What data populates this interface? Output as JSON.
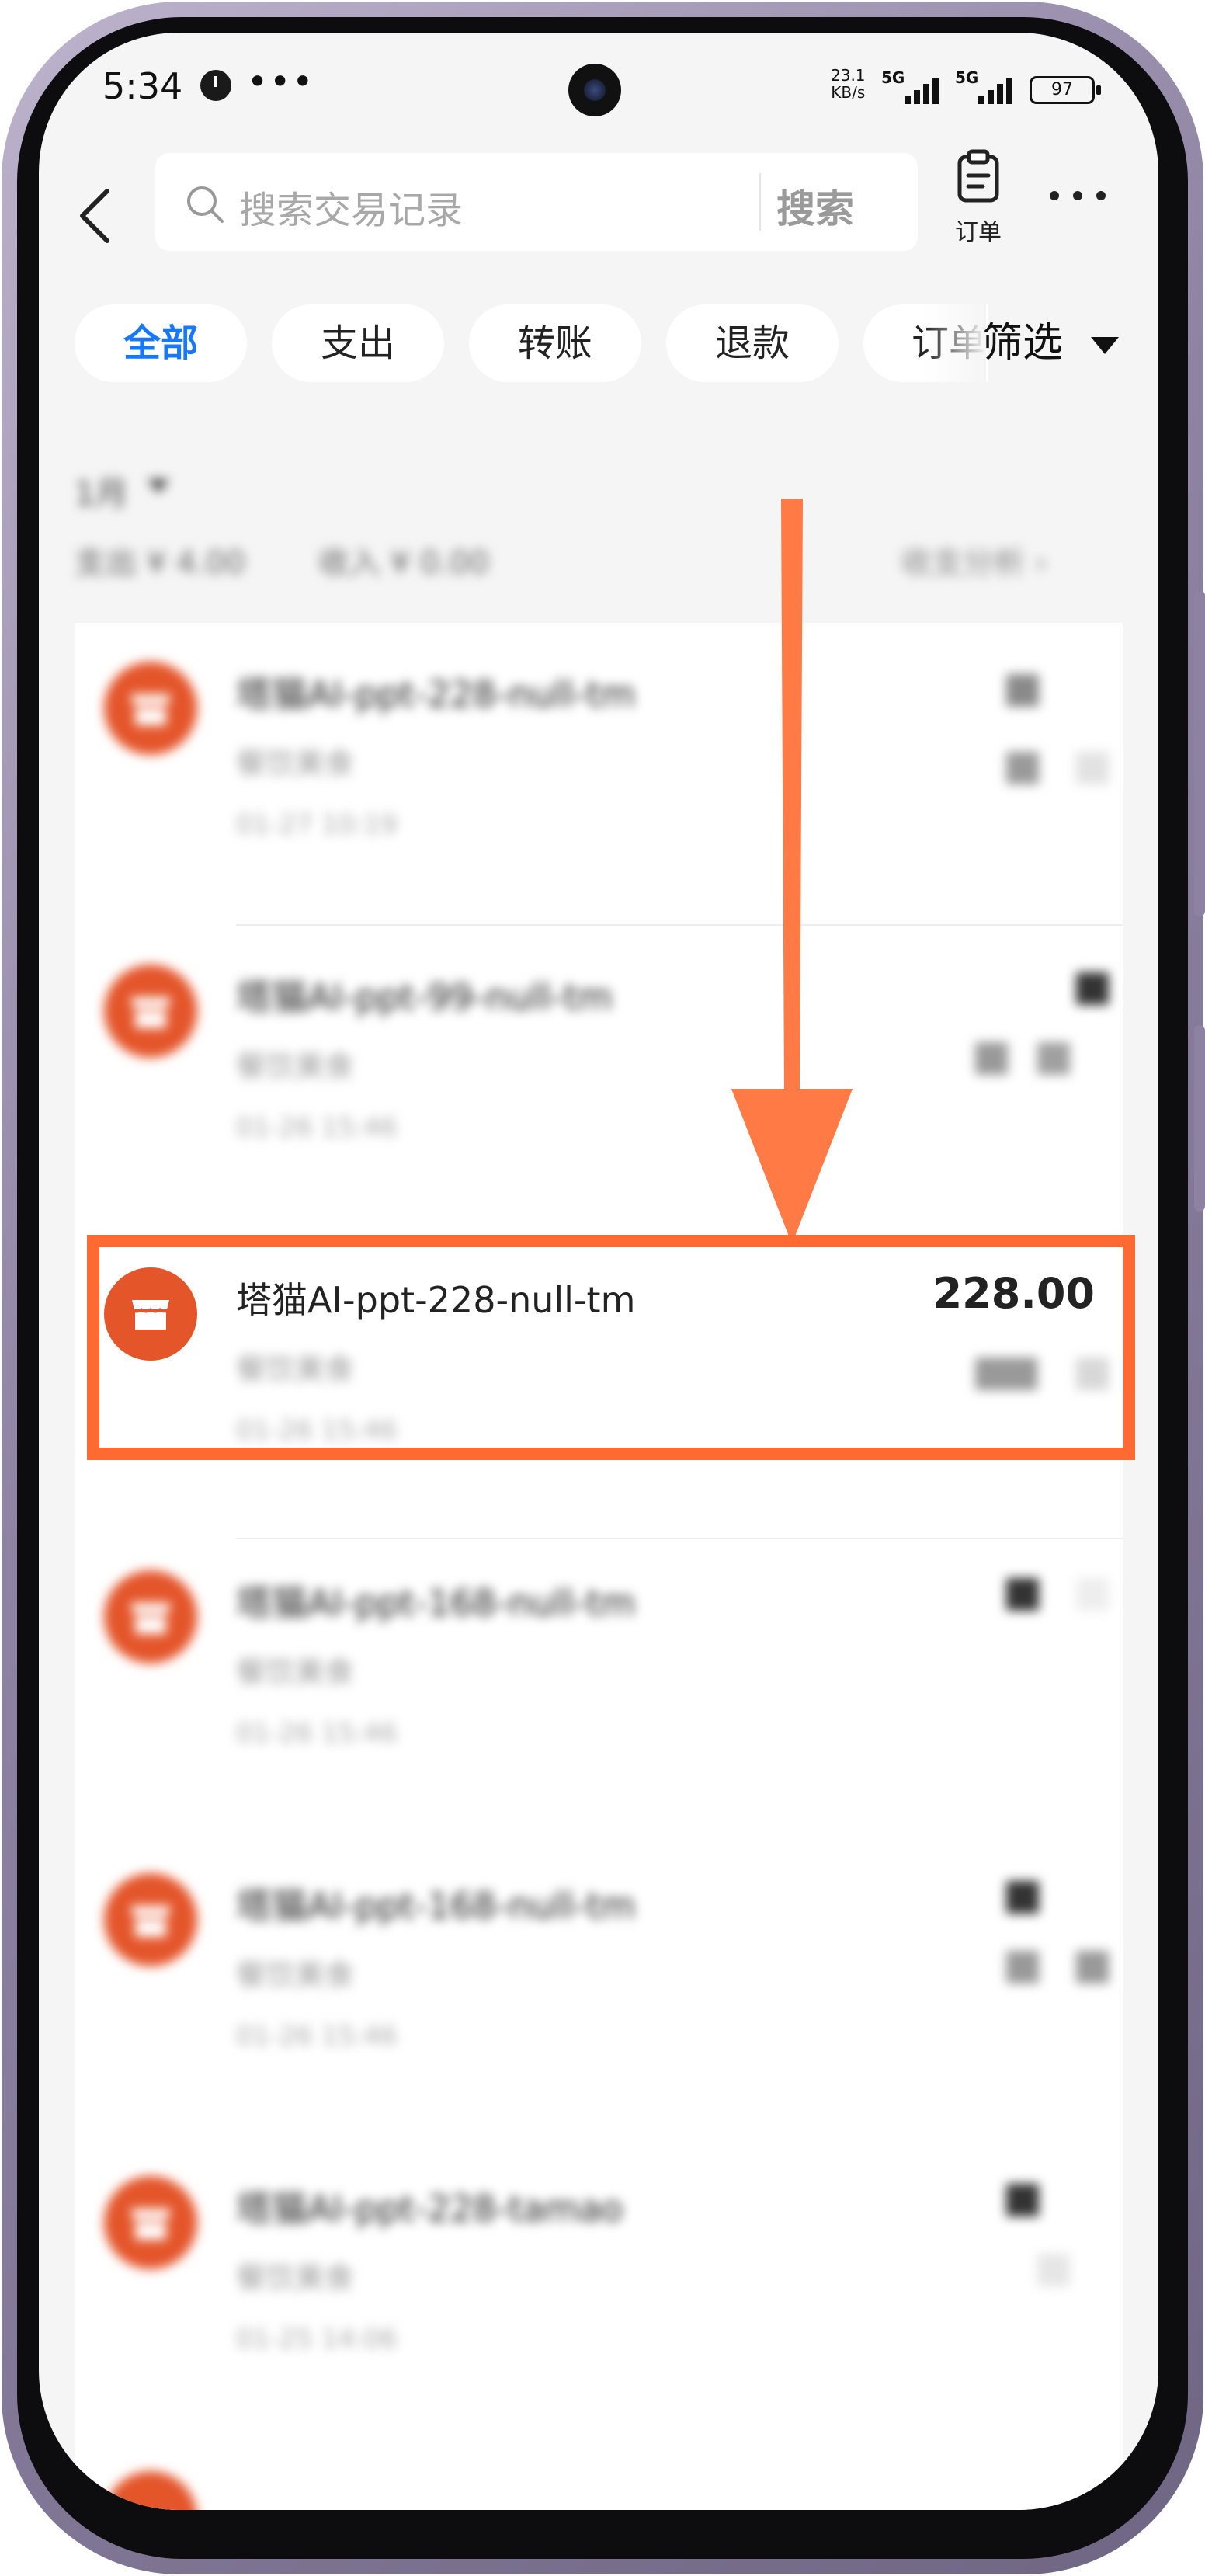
{
  "status_bar": {
    "time": "5:34",
    "more": "•••",
    "net_speed_value": "23.1",
    "net_speed_unit": "KB/s",
    "signal1_label": "5G",
    "signal2_label": "5G",
    "battery": "97"
  },
  "header": {
    "search_placeholder": "搜索交易记录",
    "search_button": "搜索",
    "orders_label": "订单"
  },
  "filters": {
    "chips": [
      "全部",
      "支出",
      "转账",
      "退款",
      "订单"
    ],
    "active": "全部",
    "filter_label": "筛选"
  },
  "summary": {
    "month": "1月",
    "expense": "支出 ¥ 4.00",
    "income": "收入 ¥ 0.00",
    "analysis": "收支分析  ›"
  },
  "transactions": [
    {
      "title": "塔猫AI-ppt-228-null-tm",
      "category": "餐饮美食",
      "time": "01-27 10:19",
      "amount": "",
      "focused": false
    },
    {
      "title": "塔猫AI-ppt-99-null-tm",
      "category": "餐饮美食",
      "time": "01-26 15:46",
      "amount": "",
      "focused": false
    },
    {
      "title": "塔猫AI-ppt-228-null-tm",
      "category": "餐饮美食",
      "time": "01-26 15:46",
      "amount": "228.00",
      "focused": true
    },
    {
      "title": "塔猫AI-ppt-168-null-tm",
      "category": "餐饮美食",
      "time": "01-26 15:46",
      "amount": "",
      "focused": false
    },
    {
      "title": "塔猫AI-ppt-168-null-tm",
      "category": "餐饮美食",
      "time": "01-26 15:46",
      "amount": "",
      "focused": false
    },
    {
      "title": "塔猫AI-ppt-228-tamao",
      "category": "餐饮美食",
      "time": "01-25 14:06",
      "amount": "",
      "focused": false
    }
  ],
  "colors": {
    "accent_blue": "#1677ff",
    "annotation_orange": "#ff6a33",
    "merchant_icon": "#e4552a"
  },
  "icons": {
    "back": "chevron-left-icon",
    "search": "search-icon",
    "orders": "clipboard-icon",
    "more": "more-dots-icon",
    "merchant": "store-icon",
    "annotation": "down-arrow-icon"
  }
}
